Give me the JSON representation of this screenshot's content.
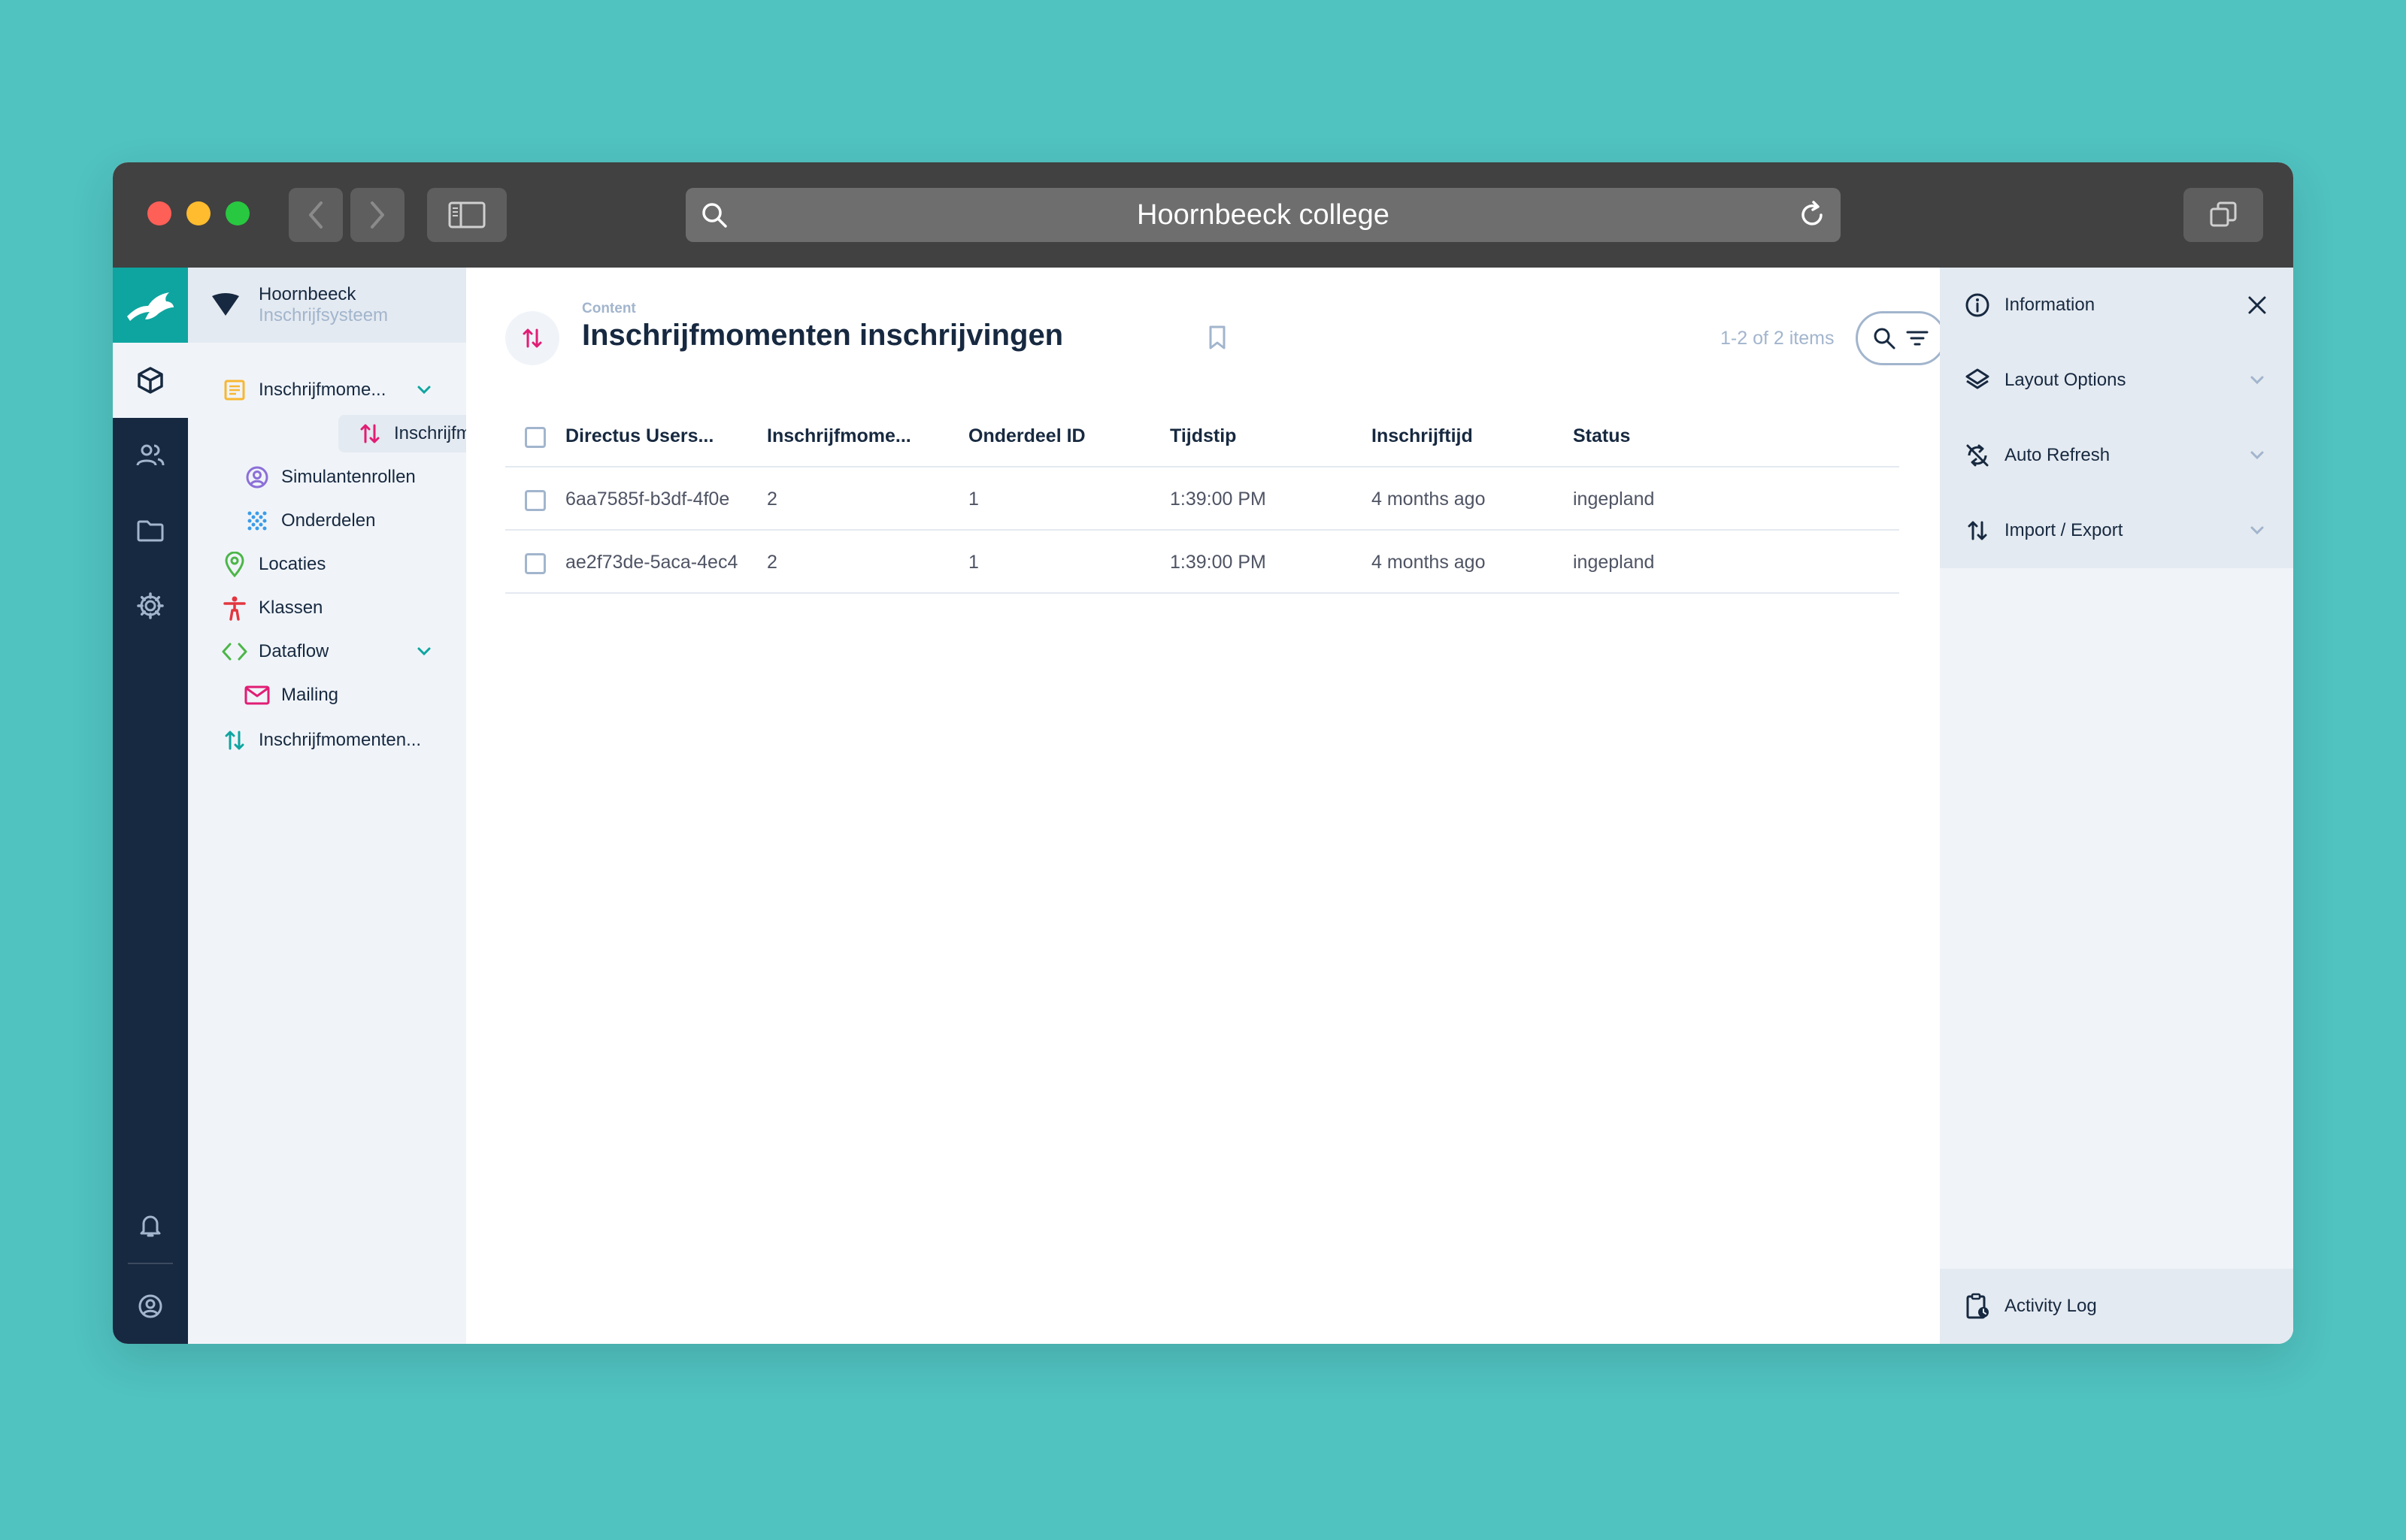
{
  "browser": {
    "url_title": "Hoornbeeck college"
  },
  "project": {
    "name": "Hoornbeeck",
    "subtitle": "Inschrijfsysteem"
  },
  "navigation": {
    "items": [
      {
        "label": "Inschrijfmome...",
        "icon": "list-box-icon",
        "color": "#f7b733",
        "expanded": true
      },
      {
        "label": "Inschrijfmoment...",
        "icon": "import-export-icon",
        "color": "#e11d74",
        "active": true
      },
      {
        "label": "Simulantenrollen",
        "icon": "account-circle-icon",
        "color": "#8c6fd8"
      },
      {
        "label": "Onderdelen",
        "icon": "scatter-dots-icon",
        "color": "#3b9ce9"
      },
      {
        "label": "Locaties",
        "icon": "location-pin-icon",
        "color": "#4cb648"
      },
      {
        "label": "Klassen",
        "icon": "accessibility-icon",
        "color": "#e3363f"
      },
      {
        "label": "Dataflow",
        "icon": "code-icon",
        "color": "#4cb648",
        "expanded": true
      },
      {
        "label": "Mailing",
        "icon": "mail-icon",
        "color": "#e11d74"
      },
      {
        "label": "Inschrijfmomenten...",
        "icon": "import-export-icon",
        "color": "#0ea5a0"
      }
    ]
  },
  "header": {
    "breadcrumb": "Content",
    "title": "Inschrijfmomenten inschrijvingen",
    "count": "1-2 of 2 items"
  },
  "table": {
    "columns": [
      "Directus Users...",
      "Inschrijfmome...",
      "Onderdeel ID",
      "Tijdstip",
      "Inschrijftijd",
      "Status"
    ],
    "rows": [
      [
        "6aa7585f-b3df-4f0e",
        "2",
        "1",
        "1:39:00 PM",
        "4 months ago",
        "ingepland"
      ],
      [
        "ae2f73de-5aca-4ec4",
        "2",
        "1",
        "1:39:00 PM",
        "4 months ago",
        "ingepland"
      ]
    ]
  },
  "sidebar": {
    "items": [
      {
        "label": "Information",
        "icon": "info-icon"
      },
      {
        "label": "Layout Options",
        "icon": "layers-icon"
      },
      {
        "label": "Auto Refresh",
        "icon": "sync-disabled-icon"
      },
      {
        "label": "Import / Export",
        "icon": "import-export-icon"
      }
    ],
    "activity_log": "Activity Log"
  },
  "colors": {
    "accent": "#0ea5a0",
    "background": "#50c2c0",
    "titlebar": "#414141",
    "module_bar": "#172940"
  }
}
